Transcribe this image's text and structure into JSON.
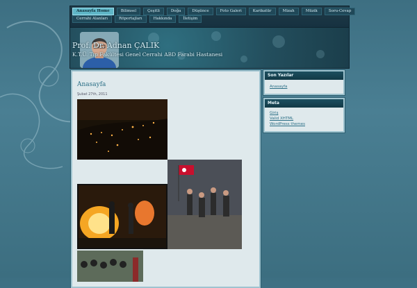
{
  "nav": {
    "row1": [
      "Anasayfa Home",
      "Bilimsel",
      "Çeşitli",
      "Doğa",
      "Düşünce",
      "Foto Galeri",
      "Karikatür",
      "Mizah",
      "Müzik",
      "Soru-Cevap"
    ],
    "row2": [
      "Cerrahi Alanları",
      "Röportajları",
      "Hakkında",
      "İletişim"
    ],
    "active": "Anasayfa Home"
  },
  "header": {
    "title": "Prof. Dr. Adnan ÇALIK",
    "subtitle": "K.T.Ü. Tıp Fakültesi Genel Cerrahi ABD Farabi Hastanesi"
  },
  "post": {
    "title": "Anasayfa",
    "date": "Şubat 27th, 2011"
  },
  "sidebar": {
    "recent": {
      "title": "Son Yazılar",
      "items": [
        "Anasayfa"
      ]
    },
    "meta": {
      "title": "Meta",
      "items": [
        "Giriş",
        "Valid XHTML",
        "WordPress themes"
      ]
    }
  },
  "colors": {
    "accent": "#5fb6c7",
    "link": "#2b6f86",
    "background": "#4a7f93"
  }
}
